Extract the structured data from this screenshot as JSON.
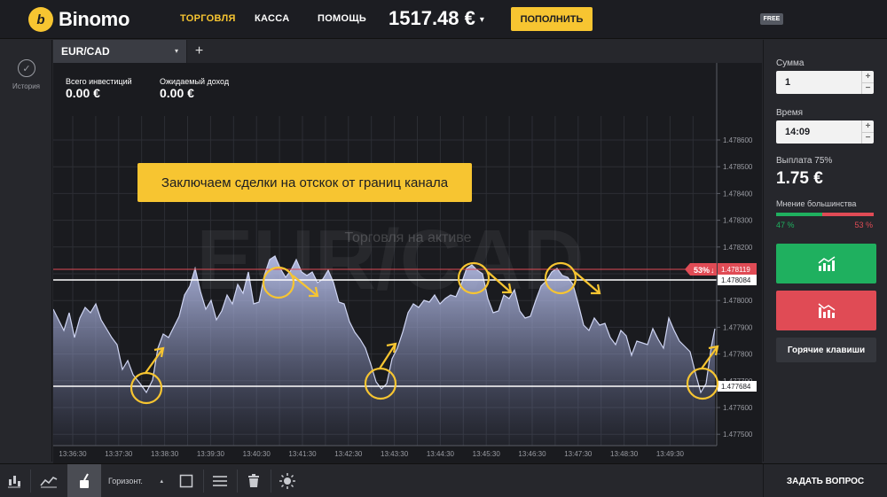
{
  "brand": {
    "logo_letter": "b",
    "name": "Binomo"
  },
  "nav": {
    "trade": "ТОРГОВЛЯ",
    "cash": "КАССА",
    "help": "ПОМОЩЬ"
  },
  "balance": {
    "value": "1517.48 €",
    "caret": "▾"
  },
  "deposit_label": "ПОПОЛНИТЬ",
  "free_badge": "FREE",
  "sidebar": {
    "history_label": "История",
    "history_icon": "check-circle-icon"
  },
  "tab": {
    "asset": "EUR/CAD",
    "caret": "▾",
    "add": "+"
  },
  "stats": {
    "invest_label": "Всего инвестиций",
    "invest_value": "0.00 €",
    "income_label": "Ожидаемый доход",
    "income_value": "0.00 €"
  },
  "callout": "Заключаем сделки на отскок от границ канала",
  "watermark": {
    "big": "EUR/CAD",
    "caption": "Торговля на активе"
  },
  "price_axis": [
    "1.478600",
    "1.478500",
    "1.478400",
    "1.478300",
    "1.478200",
    "1.478100",
    "1.478000",
    "1.477900",
    "1.477800",
    "1.477700",
    "1.477600",
    "1.477500"
  ],
  "time_axis": [
    "13:36:30",
    "13:37:30",
    "13:38:30",
    "13:39:30",
    "13:40:30",
    "13:41:30",
    "13:42:30",
    "13:43:30",
    "13:44:30",
    "13:45:30",
    "13:46:30",
    "13:47:30",
    "13:48:30",
    "13:49:30"
  ],
  "levels": {
    "current": {
      "price": "1.478119",
      "pct": "53%",
      "arrow": "↓",
      "color": "#e04b55"
    },
    "upper": {
      "price": "1.478084"
    },
    "lower": {
      "price": "1.477684"
    }
  },
  "right_panel": {
    "amount_label": "Сумма",
    "amount_value": "1",
    "time_label": "Время",
    "time_value": "14:09",
    "payout_label": "Выплата 75%",
    "payout_value": "1.75 €",
    "sentiment_label": "Мнение большинства",
    "sentiment_up": "47 %",
    "sentiment_down": "53 %",
    "sentiment_up_fraction": 0.47,
    "hotkeys_label": "Горячие клавиши",
    "stepper_plus": "+",
    "stepper_minus": "−"
  },
  "toolbar": {
    "select_value": "Горизонт.",
    "select_caret": "▴",
    "ask_label": "ЗАДАТЬ ВОПРОС"
  },
  "colors": {
    "accent": "#f7c531",
    "up": "#1fb05f",
    "down": "#e04b55"
  }
}
